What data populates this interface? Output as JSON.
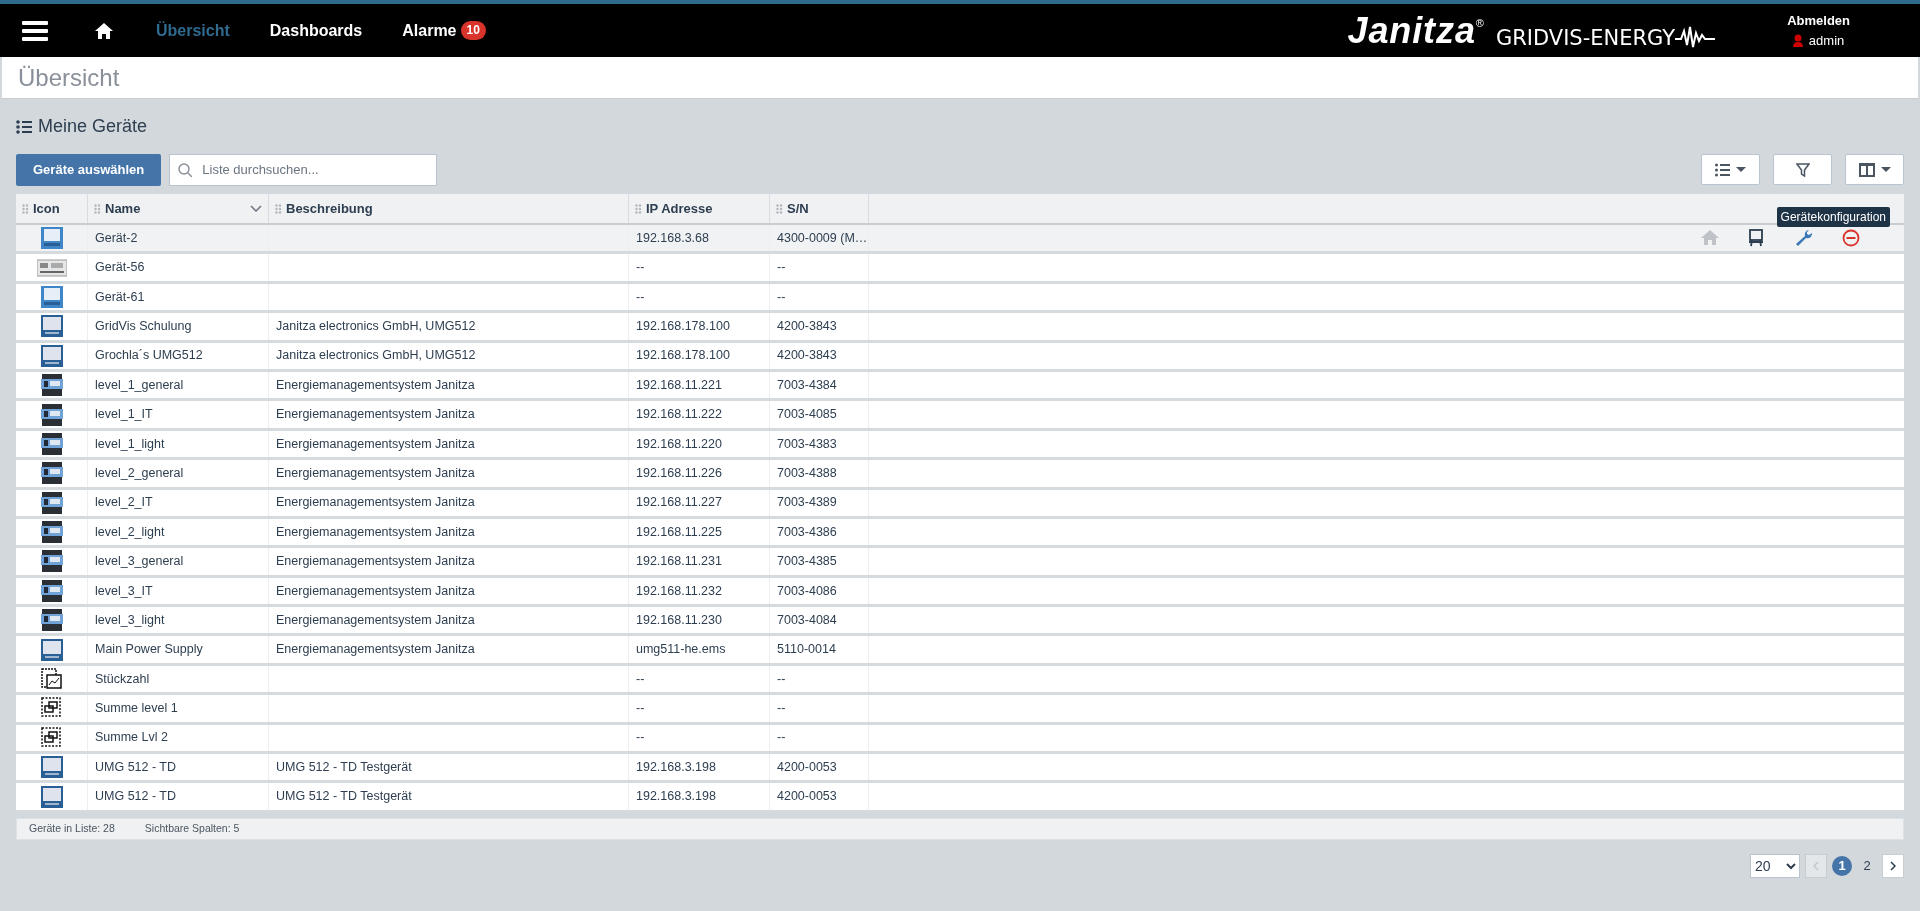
{
  "nav": {
    "items": [
      {
        "label": "Übersicht",
        "selected": true
      },
      {
        "label": "Dashboards",
        "selected": false
      },
      {
        "label": "Alarme",
        "selected": false,
        "badge": "10"
      }
    ],
    "brand": "Janitza",
    "brand_mark": "®",
    "product": "GRIDVIS-ENERGY",
    "logout": "Abmelden",
    "user": "admin"
  },
  "page_title": "Übersicht",
  "section_title": "Meine Geräte",
  "toolbar": {
    "select_button": "Geräte auswählen",
    "search": {
      "placeholder": "Liste durchsuchen..."
    }
  },
  "table": {
    "columns": [
      {
        "label": "Icon",
        "sorted": false
      },
      {
        "label": "Name",
        "sorted": true
      },
      {
        "label": "Beschreibung",
        "sorted": false
      },
      {
        "label": "IP Adresse",
        "sorted": false
      },
      {
        "label": "S/N",
        "sorted": false
      }
    ],
    "tooltip": "Gerätekonfiguration",
    "actions": [
      {
        "kind": "home",
        "disabled": true,
        "hovered": false
      },
      {
        "kind": "easel",
        "disabled": false,
        "hovered": false
      },
      {
        "kind": "wrench",
        "disabled": false,
        "hovered": true
      },
      {
        "kind": "remove",
        "disabled": false,
        "hovered": false
      }
    ],
    "rows": [
      {
        "kind": "panel-blue",
        "name": "Gerät-2",
        "description": "",
        "ip": "192.168.3.68",
        "sn": "4300-0009 (M…",
        "hovered": true
      },
      {
        "kind": "din",
        "name": "Gerät-56",
        "description": "",
        "ip": "--",
        "sn": "--",
        "hovered": false
      },
      {
        "kind": "panel-blue",
        "name": "Gerät-61",
        "description": "",
        "ip": "--",
        "sn": "--",
        "hovered": false
      },
      {
        "kind": "panel",
        "name": "GridVis Schulung",
        "description": "Janitza electronics GmbH, UMG512",
        "ip": "192.168.178.100",
        "sn": "4200-3843",
        "hovered": false
      },
      {
        "kind": "panel",
        "name": "Grochla´s UMG512",
        "description": "Janitza electronics GmbH, UMG512",
        "ip": "192.168.178.100",
        "sn": "4200-3843",
        "hovered": false
      },
      {
        "kind": "rail",
        "name": "level_1_general",
        "description": "Energiemanagementsystem Janitza",
        "ip": "192.168.11.221",
        "sn": "7003-4384",
        "hovered": false
      },
      {
        "kind": "rail",
        "name": "level_1_IT",
        "description": "Energiemanagementsystem Janitza",
        "ip": "192.168.11.222",
        "sn": "7003-4085",
        "hovered": false
      },
      {
        "kind": "rail",
        "name": "level_1_light",
        "description": "Energiemanagementsystem Janitza",
        "ip": "192.168.11.220",
        "sn": "7003-4383",
        "hovered": false
      },
      {
        "kind": "rail",
        "name": "level_2_general",
        "description": "Energiemanagementsystem Janitza",
        "ip": "192.168.11.226",
        "sn": "7003-4388",
        "hovered": false
      },
      {
        "kind": "rail",
        "name": "level_2_IT",
        "description": "Energiemanagementsystem Janitza",
        "ip": "192.168.11.227",
        "sn": "7003-4389",
        "hovered": false
      },
      {
        "kind": "rail",
        "name": "level_2_light",
        "description": "Energiemanagementsystem Janitza",
        "ip": "192.168.11.225",
        "sn": "7003-4386",
        "hovered": false
      },
      {
        "kind": "rail",
        "name": "level_3_general",
        "description": "Energiemanagementsystem Janitza",
        "ip": "192.168.11.231",
        "sn": "7003-4385",
        "hovered": false
      },
      {
        "kind": "rail",
        "name": "level_3_IT",
        "description": "Energiemanagementsystem Janitza",
        "ip": "192.168.11.232",
        "sn": "7003-4086",
        "hovered": false
      },
      {
        "kind": "rail",
        "name": "level_3_light",
        "description": "Energiemanagementsystem Janitza",
        "ip": "192.168.11.230",
        "sn": "7003-4084",
        "hovered": false
      },
      {
        "kind": "panel",
        "name": "Main Power Supply",
        "description": "Energiemanagementsystem Janitza",
        "ip": "umg511-he.ems",
        "sn": "5110-0014",
        "hovered": false
      },
      {
        "kind": "chart",
        "name": "Stückzahl",
        "description": "",
        "ip": "--",
        "sn": "--",
        "hovered": false
      },
      {
        "kind": "virtual",
        "name": "Summe level 1",
        "description": "",
        "ip": "--",
        "sn": "--",
        "hovered": false
      },
      {
        "kind": "virtual",
        "name": "Summe Lvl 2",
        "description": "",
        "ip": "--",
        "sn": "--",
        "hovered": false
      },
      {
        "kind": "panel",
        "name": "UMG 512 - TD",
        "description": "UMG 512 - TD Testgerät",
        "ip": "192.168.3.198",
        "sn": "4200-0053",
        "hovered": false
      },
      {
        "kind": "panel",
        "name": "UMG 512 - TD",
        "description": "UMG 512 - TD Testgerät",
        "ip": "192.168.3.198",
        "sn": "4200-0053",
        "hovered": false
      }
    ]
  },
  "footer": {
    "count_label": "Geräte in Liste:",
    "count": "28",
    "columns_label": "Sichtbare Spalten:",
    "columns": "5"
  },
  "pagination": {
    "page_size": "20",
    "prev_disabled": true,
    "pages": [
      {
        "label": "1",
        "selected": true
      },
      {
        "label": "2",
        "selected": false
      }
    ]
  }
}
